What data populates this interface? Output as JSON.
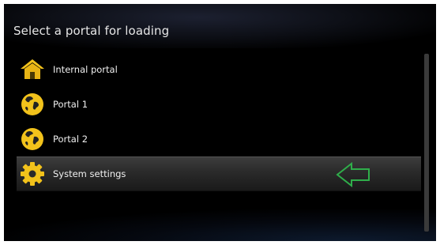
{
  "title": "Select a portal for loading",
  "items": [
    {
      "label": "Internal portal",
      "icon": "home-icon"
    },
    {
      "label": "Portal 1",
      "icon": "globe-icon"
    },
    {
      "label": "Portal 2",
      "icon": "globe-icon"
    },
    {
      "label": "System settings",
      "icon": "gear-icon",
      "selected": true
    }
  ],
  "selection_indicator": {
    "icon": "left-arrow-icon",
    "color": "#2fae4a"
  },
  "colors": {
    "icon_yellow": "#f2c21b",
    "background": "#000000"
  }
}
